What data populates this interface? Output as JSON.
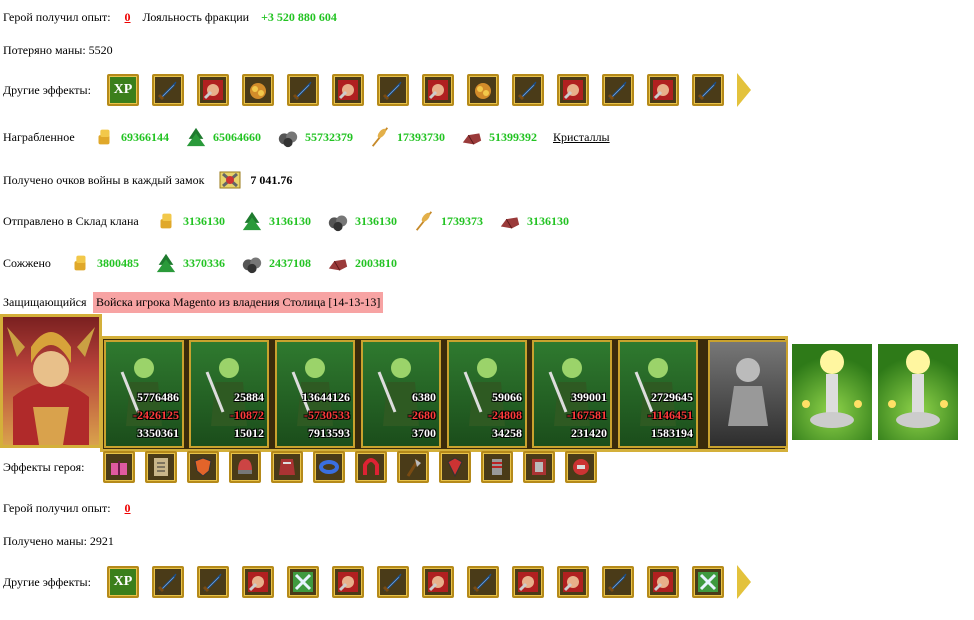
{
  "line1": {
    "exp_label": "Герой получил опыт:",
    "exp_value": "0",
    "loyalty_label": "Лояльность фракции",
    "loyalty_value": "+3 520 880 604"
  },
  "mana_lost": "Потеряно маны: 5520",
  "other_effects_1": {
    "label": "Другие эффекты:",
    "icons": [
      "xp-icon",
      "sword-icon",
      "fist-icon",
      "gold-sack-icon",
      "sword-icon",
      "fist-icon",
      "sword-icon",
      "fist-icon",
      "gold-sack-icon",
      "sword-icon",
      "fist-icon",
      "sword-icon",
      "fist-icon",
      "sword-icon"
    ]
  },
  "plunder": {
    "label": "Награбленное",
    "items": [
      {
        "icon": "gold-icon",
        "value": "69366144"
      },
      {
        "icon": "wood-icon",
        "value": "65064660"
      },
      {
        "icon": "ore-icon",
        "value": "55732379"
      },
      {
        "icon": "wheat-icon",
        "value": "17393730"
      },
      {
        "icon": "stone-icon",
        "value": "51399392"
      }
    ],
    "crystals_link": "Кристаллы"
  },
  "war_points": {
    "label": "Получено очков войны в каждый замок",
    "value": "7 041.76"
  },
  "clan_storage": {
    "label": "Отправлено в Склад клана",
    "items": [
      {
        "icon": "gold-icon",
        "value": "3136130"
      },
      {
        "icon": "wood-icon",
        "value": "3136130"
      },
      {
        "icon": "ore-icon",
        "value": "3136130"
      },
      {
        "icon": "wheat-icon",
        "value": "1739373"
      },
      {
        "icon": "stone-icon",
        "value": "3136130"
      }
    ]
  },
  "burned": {
    "label": "Сожжено",
    "items": [
      {
        "icon": "gold-icon",
        "value": "3800485"
      },
      {
        "icon": "wood-icon",
        "value": "3370336"
      },
      {
        "icon": "ore-icon",
        "value": "2437108"
      },
      {
        "icon": "stone-icon",
        "value": "2003810"
      }
    ]
  },
  "defender": {
    "label": "Защищающийся",
    "value": "Войска игрока Magento из владения Столица [14-13-13]"
  },
  "units": [
    {
      "a": "5776486",
      "b": "-2426125",
      "c": "3350361"
    },
    {
      "a": "25884",
      "b": "-10872",
      "c": "15012"
    },
    {
      "a": "13644126",
      "b": "-5730533",
      "c": "7913593"
    },
    {
      "a": "6380",
      "b": "-2680",
      "c": "3700"
    },
    {
      "a": "59066",
      "b": "-24808",
      "c": "34258"
    },
    {
      "a": "399001",
      "b": "-167581",
      "c": "231420"
    },
    {
      "a": "2729645",
      "b": "-1146451",
      "c": "1583194"
    }
  ],
  "hero_effects": {
    "label": "Эффекты героя:",
    "icons": [
      "gift-icon",
      "scroll-icon",
      "shield-icon",
      "helmet-icon",
      "armor-icon",
      "ring-icon",
      "horseshoe-icon",
      "axe-icon",
      "kite-shield-icon",
      "gauntlet-icon",
      "chainmail-icon",
      "helmet-gold-icon"
    ]
  },
  "line_exp2": {
    "label": "Герой получил опыт:",
    "value": "0"
  },
  "mana_gained": "Получено маны: 2921",
  "other_effects_2": {
    "label": "Другие эффекты:",
    "icons": [
      "xp-icon",
      "sword-icon",
      "sword-icon",
      "fist-icon",
      "crossed-sword-icon",
      "fist-icon",
      "sword-icon",
      "fist-icon",
      "sword-icon",
      "fist-icon",
      "fist-icon",
      "sword-icon",
      "fist-icon",
      "crossed-sword-icon"
    ]
  },
  "xp_text": "XP",
  "colors": {
    "green": "#22c322",
    "red": "#e00000",
    "gold_border": "#d4b03a",
    "defender_bg": "#f7a3a3"
  }
}
